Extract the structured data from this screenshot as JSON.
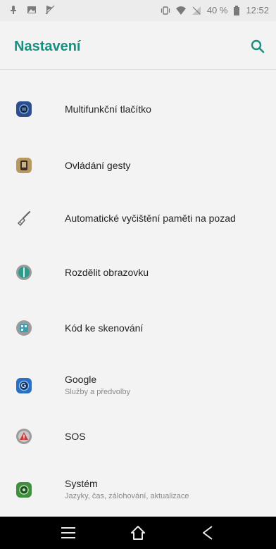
{
  "status_bar": {
    "battery_percent": "40 %",
    "time": "12:52"
  },
  "app_bar": {
    "title": "Nastavení"
  },
  "items": [
    {
      "title": "Multifunkční tlačítko",
      "subtitle": "",
      "icon": "multifunction-button-icon"
    },
    {
      "title": "Ovládání gesty",
      "subtitle": "",
      "icon": "gesture-control-icon"
    },
    {
      "title": "Automatické vyčištění paměti na pozad",
      "subtitle": "",
      "icon": "broom-icon"
    },
    {
      "title": "Rozdělit obrazovku",
      "subtitle": "",
      "icon": "split-screen-icon"
    },
    {
      "title": "Kód ke skenování",
      "subtitle": "",
      "icon": "scan-code-icon"
    },
    {
      "title": "Google",
      "subtitle": "Služby a předvolby",
      "icon": "google-icon"
    },
    {
      "title": "SOS",
      "subtitle": "",
      "icon": "sos-icon"
    },
    {
      "title": "Systém",
      "subtitle": "Jazyky, čas, zálohování, aktualizace",
      "icon": "system-icon"
    }
  ]
}
